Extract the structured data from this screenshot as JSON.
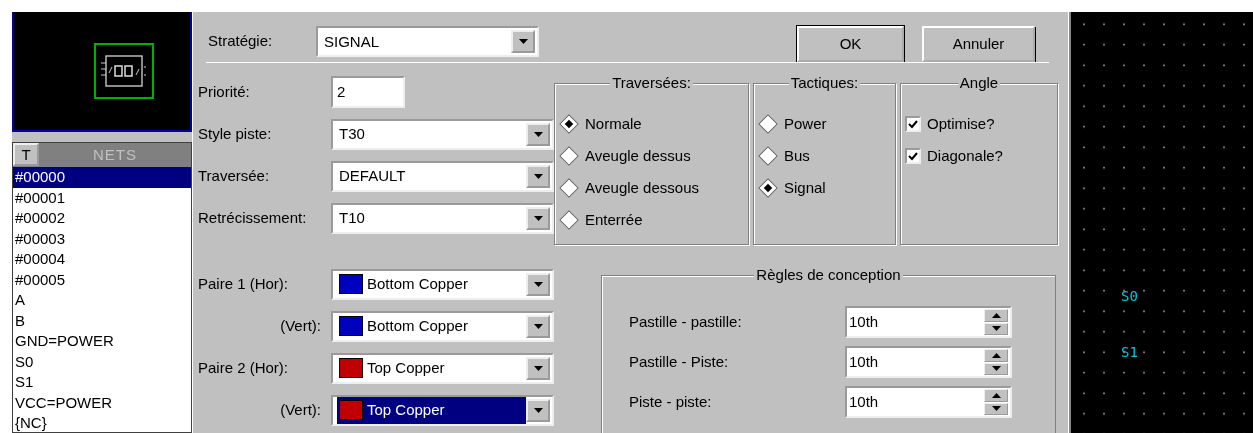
{
  "nets": {
    "toggle": "T",
    "title": "NETS",
    "items": [
      {
        "label": "#00000",
        "selected": true
      },
      {
        "label": "#00001",
        "selected": false
      },
      {
        "label": "#00002",
        "selected": false
      },
      {
        "label": "#00003",
        "selected": false
      },
      {
        "label": "#00004",
        "selected": false
      },
      {
        "label": "#00005",
        "selected": false
      },
      {
        "label": "A",
        "selected": false
      },
      {
        "label": "B",
        "selected": false
      },
      {
        "label": "GND=POWER",
        "selected": false
      },
      {
        "label": "S0",
        "selected": false
      },
      {
        "label": "S1",
        "selected": false
      },
      {
        "label": "VCC=POWER",
        "selected": false
      },
      {
        "label": "{NC}",
        "selected": false
      }
    ]
  },
  "strategy": {
    "label": "Stratégie:",
    "value": "SIGNAL"
  },
  "buttons": [
    {
      "label": "OK",
      "default": true
    },
    {
      "label": "Annuler",
      "default": false
    }
  ],
  "fields": [
    {
      "label": "Priorité:",
      "kind": "input",
      "value": "2"
    },
    {
      "label": "Style piste:",
      "kind": "combo",
      "value": "T30"
    },
    {
      "label": "Traversée:",
      "kind": "combo",
      "value": "DEFAULT"
    },
    {
      "label": "Retrécissement:",
      "kind": "combo",
      "value": "T10"
    }
  ],
  "groups": [
    {
      "title": "Traversées:",
      "kind": "radio",
      "options": [
        {
          "label": "Normale",
          "selected": true
        },
        {
          "label": "Aveugle dessus",
          "selected": false
        },
        {
          "label": "Aveugle dessous",
          "selected": false
        },
        {
          "label": "Enterrée",
          "selected": false
        }
      ]
    },
    {
      "title": "Tactiques:",
      "kind": "radio",
      "options": [
        {
          "label": "Power",
          "selected": false
        },
        {
          "label": "Bus",
          "selected": false
        },
        {
          "label": "Signal",
          "selected": true
        }
      ]
    },
    {
      "title": "Angle",
      "kind": "checkbox",
      "options": [
        {
          "label": "Optimise?",
          "checked": true
        },
        {
          "label": "Diagonale?",
          "checked": true
        }
      ]
    }
  ],
  "layer_pairs": [
    {
      "label": "Paire 1 (Hor):",
      "value": "Bottom Copper",
      "color": "#0000c0",
      "selected": false
    },
    {
      "label": "(Vert):",
      "value": "Bottom Copper",
      "color": "#0000c0",
      "selected": false
    },
    {
      "label": "Paire 2 (Hor):",
      "value": "Top Copper",
      "color": "#c00000",
      "selected": false
    },
    {
      "label": "(Vert):",
      "value": "Top Copper",
      "color": "#c00000",
      "selected": true
    }
  ],
  "design_rules": {
    "title": "Règles de conception",
    "rows": [
      {
        "label": "Pastille - pastille:",
        "value": "10th"
      },
      {
        "label": "Pastille - Piste:",
        "value": "10th"
      },
      {
        "label": "Piste - piste:",
        "value": "10th"
      }
    ]
  },
  "canvas": {
    "labels": [
      "S0",
      "S1"
    ]
  }
}
